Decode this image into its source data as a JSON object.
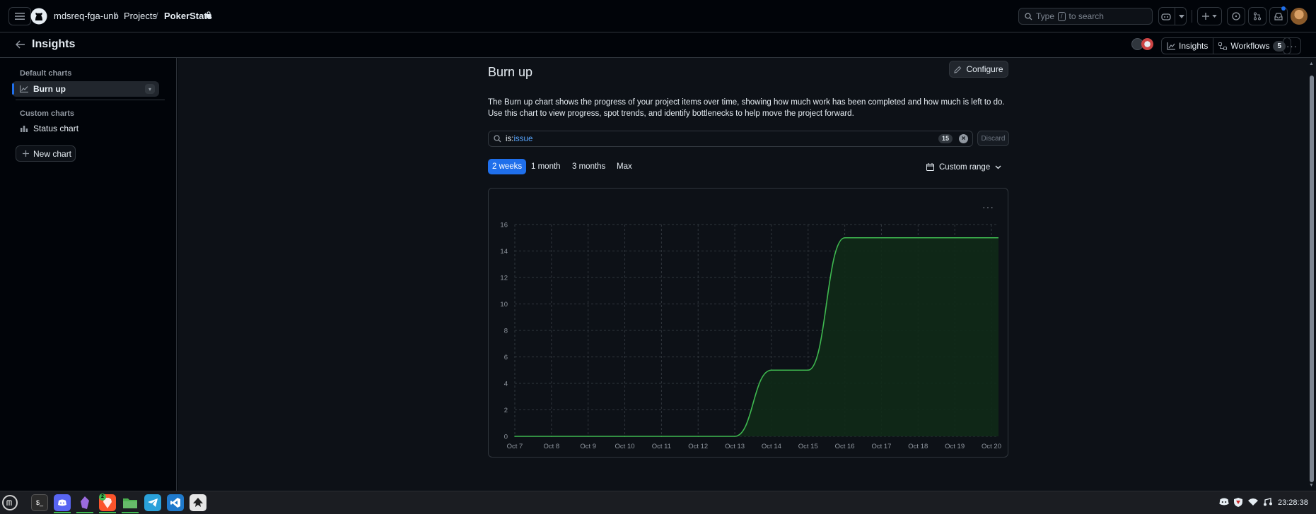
{
  "header": {
    "owner": "mdsreq-fga-unb",
    "projects": "Projects",
    "project": "PokerStats",
    "sep": "/",
    "search_placeholder_pre": "Type",
    "search_key": "/",
    "search_placeholder_post": "to search"
  },
  "subheader": {
    "title": "Insights",
    "insights_label": "Insights",
    "workflows_label": "Workflows",
    "workflows_count": "5"
  },
  "sidebar": {
    "default_label": "Default charts",
    "custom_label": "Custom charts",
    "items": [
      {
        "label": "Burn up"
      },
      {
        "label": "Status chart"
      }
    ],
    "new_chart_label": "New chart"
  },
  "main": {
    "title": "Burn up",
    "configure_label": "Configure",
    "description": "The Burn up chart shows the progress of your project items over time, showing how much work has been completed and how much is left to do. Use this chart to view progress, spot trends, and identify bottlenecks to help move the project forward.",
    "filter_key": "is:",
    "filter_value": "issue",
    "filter_count": "15",
    "discard_label": "Discard",
    "ranges": [
      "2 weeks",
      "1 month",
      "3 months",
      "Max"
    ],
    "active_range": "2 weeks",
    "custom_range_label": "Custom range"
  },
  "chart_data": {
    "type": "area",
    "x": [
      "Oct 7",
      "Oct 8",
      "Oct 9",
      "Oct 10",
      "Oct 11",
      "Oct 12",
      "Oct 13",
      "Oct 14",
      "Oct 15",
      "Oct 16",
      "Oct 17",
      "Oct 18",
      "Oct 19",
      "Oct 20"
    ],
    "series": [
      {
        "values": [
          0,
          0,
          0,
          0,
          0,
          0,
          0,
          5,
          5,
          15,
          15,
          15,
          15,
          15
        ],
        "color": "#3fb950"
      }
    ],
    "yticks": [
      0,
      2,
      4,
      6,
      8,
      10,
      12,
      14,
      16
    ],
    "ylim": [
      0,
      16
    ],
    "grid": true,
    "legend": "none"
  },
  "taskbar": {
    "clock": "23:28:38",
    "brave_badge": "2"
  },
  "colors": {
    "accent": "#1f6feb",
    "line": "#3fb950",
    "fill": "#0f2a17"
  }
}
